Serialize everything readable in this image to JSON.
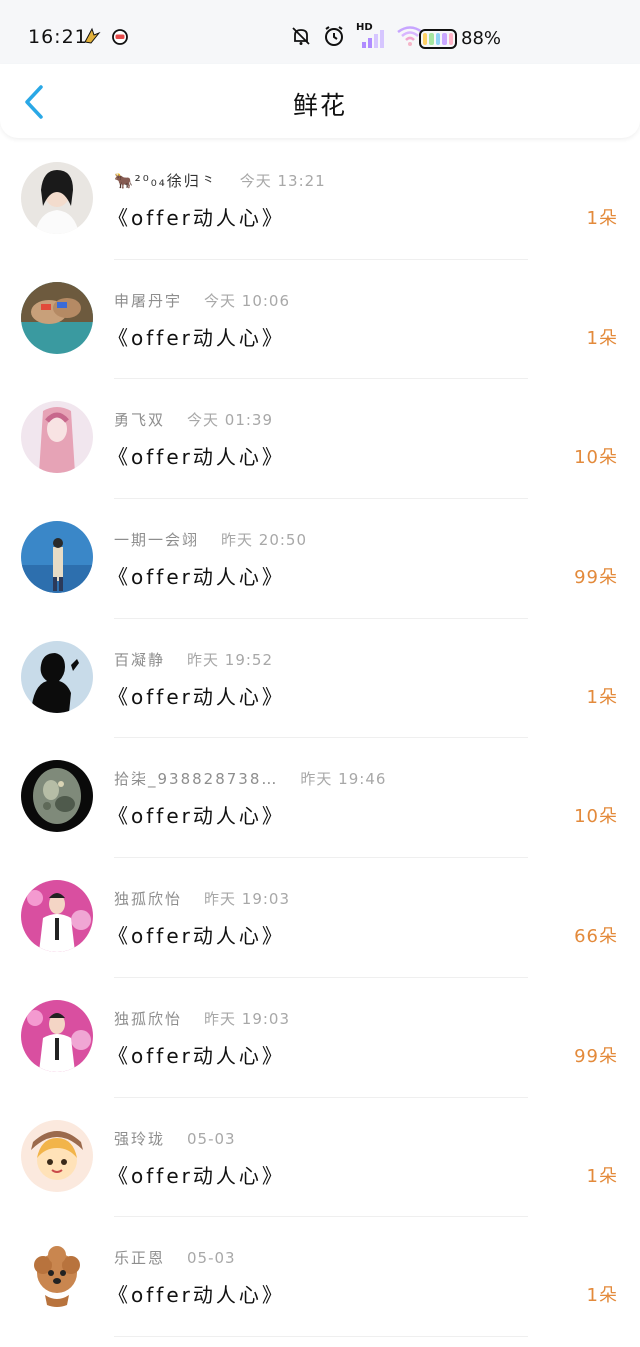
{
  "status_bar": {
    "time": "16:21",
    "hd_label": "HD",
    "battery_text": "88%"
  },
  "header": {
    "title": "鲜花",
    "back_icon": "chevron-left-icon",
    "accent": "#2aa8e6"
  },
  "colors": {
    "count": "#e38a3b",
    "name": "#8e8e8e",
    "time": "#a8a8a8"
  },
  "items": [
    {
      "name": "🐂²⁰₀₄徐归⺀",
      "time": "今天 13:21",
      "gift": "《offer动人心》",
      "count": "1朵",
      "avatar": "avatar-woman-white"
    },
    {
      "name": "申屠丹宇",
      "time": "今天 10:06",
      "gift": "《offer动人心》",
      "count": "1朵",
      "avatar": "avatar-hands-ring"
    },
    {
      "name": "勇飞双",
      "time": "今天 01:39",
      "gift": "《offer动人心》",
      "count": "10朵",
      "avatar": "avatar-pink-hair"
    },
    {
      "name": "一期一会翊",
      "time": "昨天 20:50",
      "gift": "《offer动人心》",
      "count": "99朵",
      "avatar": "avatar-sea-person"
    },
    {
      "name": "百凝静",
      "time": "昨天 19:52",
      "gift": "《offer动人心》",
      "count": "1朵",
      "avatar": "avatar-silhouette"
    },
    {
      "name": "拾柒_938828738…",
      "time": "昨天 19:46",
      "gift": "《offer动人心》",
      "count": "10朵",
      "avatar": "avatar-stone"
    },
    {
      "name": "独孤欣怡",
      "time": "昨天 19:03",
      "gift": "《offer动人心》",
      "count": "66朵",
      "avatar": "avatar-stage-man"
    },
    {
      "name": "独孤欣怡",
      "time": "昨天 19:03",
      "gift": "《offer动人心》",
      "count": "99朵",
      "avatar": "avatar-stage-man"
    },
    {
      "name": "强玲珑",
      "time": "05-03",
      "gift": "《offer动人心》",
      "count": "1朵",
      "avatar": "avatar-cartoon-girl"
    },
    {
      "name": "乐正恩",
      "time": "05-03",
      "gift": "《offer动人心》",
      "count": "1朵",
      "avatar": "avatar-dog"
    }
  ]
}
